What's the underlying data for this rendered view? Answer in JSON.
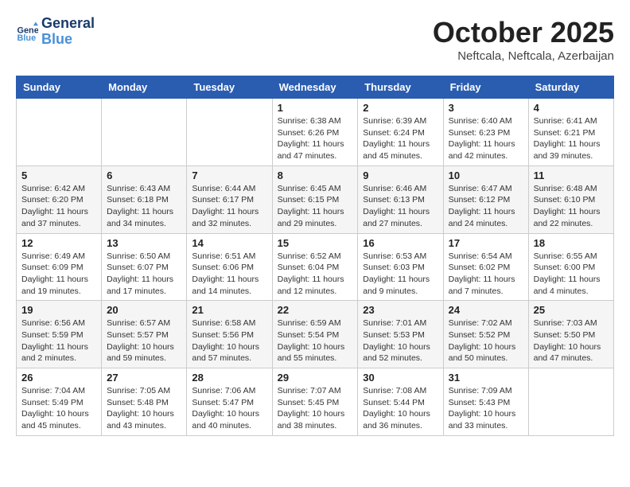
{
  "logo": {
    "line1": "General",
    "line2": "Blue"
  },
  "title": "October 2025",
  "subtitle": "Neftcala, Neftcala, Azerbaijan",
  "days_of_week": [
    "Sunday",
    "Monday",
    "Tuesday",
    "Wednesday",
    "Thursday",
    "Friday",
    "Saturday"
  ],
  "weeks": [
    [
      {
        "day": "",
        "info": ""
      },
      {
        "day": "",
        "info": ""
      },
      {
        "day": "",
        "info": ""
      },
      {
        "day": "1",
        "info": "Sunrise: 6:38 AM\nSunset: 6:26 PM\nDaylight: 11 hours and 47 minutes."
      },
      {
        "day": "2",
        "info": "Sunrise: 6:39 AM\nSunset: 6:24 PM\nDaylight: 11 hours and 45 minutes."
      },
      {
        "day": "3",
        "info": "Sunrise: 6:40 AM\nSunset: 6:23 PM\nDaylight: 11 hours and 42 minutes."
      },
      {
        "day": "4",
        "info": "Sunrise: 6:41 AM\nSunset: 6:21 PM\nDaylight: 11 hours and 39 minutes."
      }
    ],
    [
      {
        "day": "5",
        "info": "Sunrise: 6:42 AM\nSunset: 6:20 PM\nDaylight: 11 hours and 37 minutes."
      },
      {
        "day": "6",
        "info": "Sunrise: 6:43 AM\nSunset: 6:18 PM\nDaylight: 11 hours and 34 minutes."
      },
      {
        "day": "7",
        "info": "Sunrise: 6:44 AM\nSunset: 6:17 PM\nDaylight: 11 hours and 32 minutes."
      },
      {
        "day": "8",
        "info": "Sunrise: 6:45 AM\nSunset: 6:15 PM\nDaylight: 11 hours and 29 minutes."
      },
      {
        "day": "9",
        "info": "Sunrise: 6:46 AM\nSunset: 6:13 PM\nDaylight: 11 hours and 27 minutes."
      },
      {
        "day": "10",
        "info": "Sunrise: 6:47 AM\nSunset: 6:12 PM\nDaylight: 11 hours and 24 minutes."
      },
      {
        "day": "11",
        "info": "Sunrise: 6:48 AM\nSunset: 6:10 PM\nDaylight: 11 hours and 22 minutes."
      }
    ],
    [
      {
        "day": "12",
        "info": "Sunrise: 6:49 AM\nSunset: 6:09 PM\nDaylight: 11 hours and 19 minutes."
      },
      {
        "day": "13",
        "info": "Sunrise: 6:50 AM\nSunset: 6:07 PM\nDaylight: 11 hours and 17 minutes."
      },
      {
        "day": "14",
        "info": "Sunrise: 6:51 AM\nSunset: 6:06 PM\nDaylight: 11 hours and 14 minutes."
      },
      {
        "day": "15",
        "info": "Sunrise: 6:52 AM\nSunset: 6:04 PM\nDaylight: 11 hours and 12 minutes."
      },
      {
        "day": "16",
        "info": "Sunrise: 6:53 AM\nSunset: 6:03 PM\nDaylight: 11 hours and 9 minutes."
      },
      {
        "day": "17",
        "info": "Sunrise: 6:54 AM\nSunset: 6:02 PM\nDaylight: 11 hours and 7 minutes."
      },
      {
        "day": "18",
        "info": "Sunrise: 6:55 AM\nSunset: 6:00 PM\nDaylight: 11 hours and 4 minutes."
      }
    ],
    [
      {
        "day": "19",
        "info": "Sunrise: 6:56 AM\nSunset: 5:59 PM\nDaylight: 11 hours and 2 minutes."
      },
      {
        "day": "20",
        "info": "Sunrise: 6:57 AM\nSunset: 5:57 PM\nDaylight: 10 hours and 59 minutes."
      },
      {
        "day": "21",
        "info": "Sunrise: 6:58 AM\nSunset: 5:56 PM\nDaylight: 10 hours and 57 minutes."
      },
      {
        "day": "22",
        "info": "Sunrise: 6:59 AM\nSunset: 5:54 PM\nDaylight: 10 hours and 55 minutes."
      },
      {
        "day": "23",
        "info": "Sunrise: 7:01 AM\nSunset: 5:53 PM\nDaylight: 10 hours and 52 minutes."
      },
      {
        "day": "24",
        "info": "Sunrise: 7:02 AM\nSunset: 5:52 PM\nDaylight: 10 hours and 50 minutes."
      },
      {
        "day": "25",
        "info": "Sunrise: 7:03 AM\nSunset: 5:50 PM\nDaylight: 10 hours and 47 minutes."
      }
    ],
    [
      {
        "day": "26",
        "info": "Sunrise: 7:04 AM\nSunset: 5:49 PM\nDaylight: 10 hours and 45 minutes."
      },
      {
        "day": "27",
        "info": "Sunrise: 7:05 AM\nSunset: 5:48 PM\nDaylight: 10 hours and 43 minutes."
      },
      {
        "day": "28",
        "info": "Sunrise: 7:06 AM\nSunset: 5:47 PM\nDaylight: 10 hours and 40 minutes."
      },
      {
        "day": "29",
        "info": "Sunrise: 7:07 AM\nSunset: 5:45 PM\nDaylight: 10 hours and 38 minutes."
      },
      {
        "day": "30",
        "info": "Sunrise: 7:08 AM\nSunset: 5:44 PM\nDaylight: 10 hours and 36 minutes."
      },
      {
        "day": "31",
        "info": "Sunrise: 7:09 AM\nSunset: 5:43 PM\nDaylight: 10 hours and 33 minutes."
      },
      {
        "day": "",
        "info": ""
      }
    ]
  ]
}
